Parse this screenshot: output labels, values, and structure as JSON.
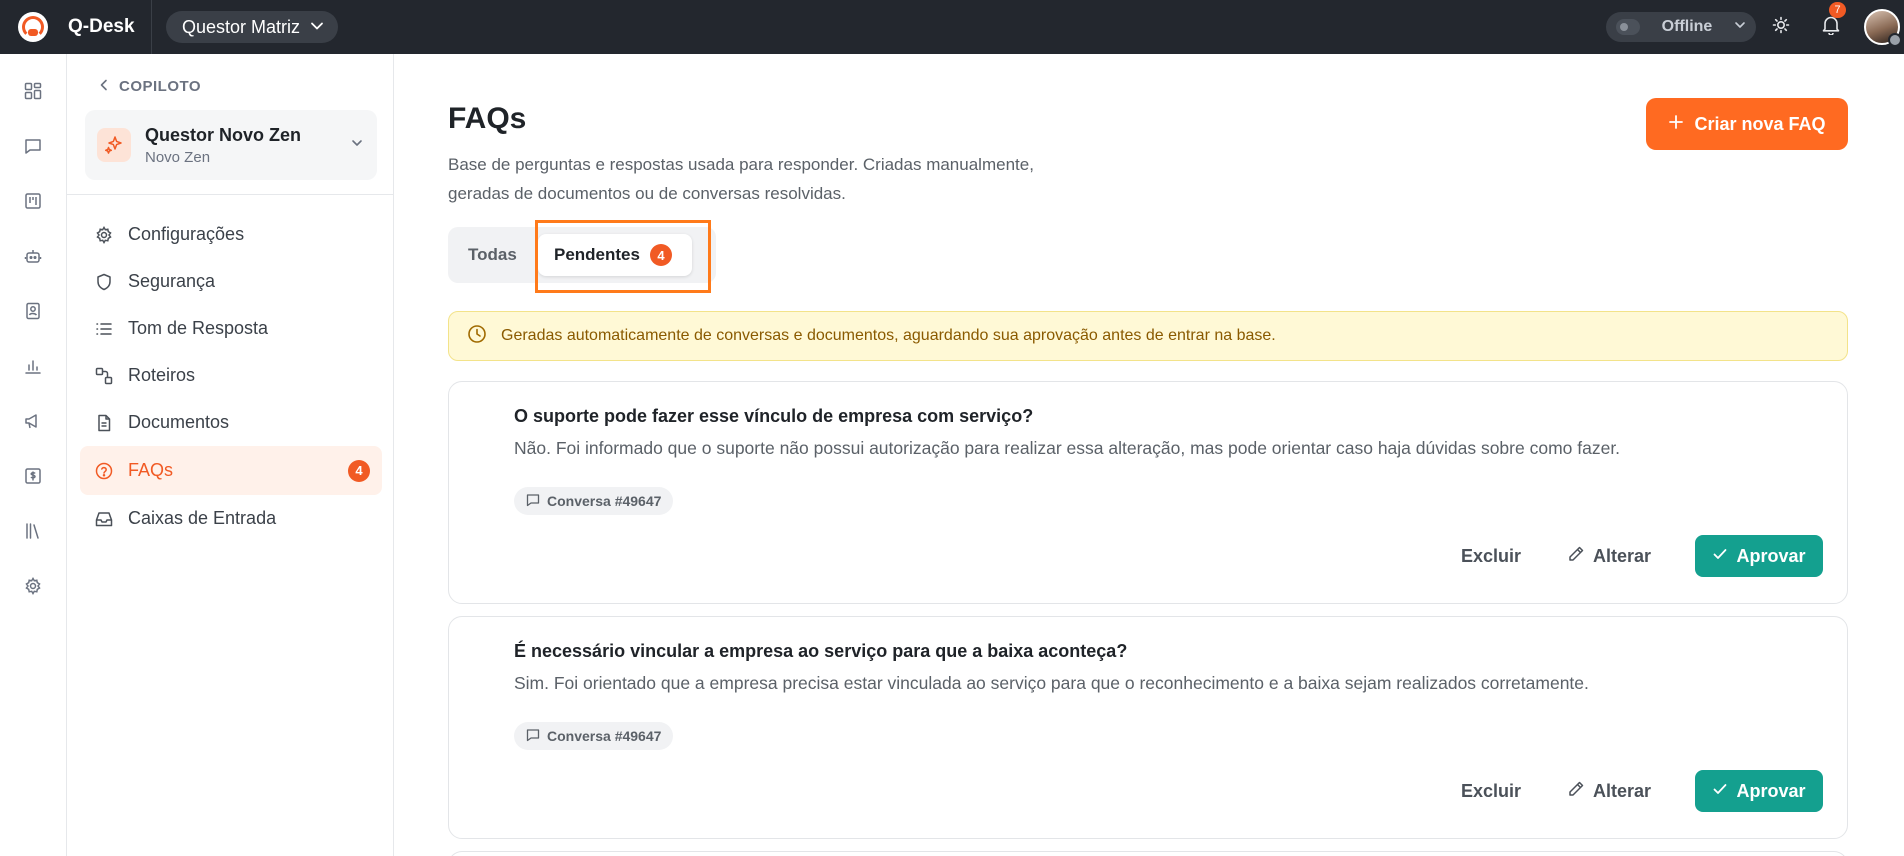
{
  "app": {
    "name": "Q-Desk",
    "workspace": "Questor Matriz",
    "status": "Offline",
    "notifications_count": "7"
  },
  "rail": {
    "icons": [
      "dashboard-icon",
      "chat-icon",
      "kanban-icon",
      "bot-icon",
      "contacts-icon",
      "reports-icon",
      "campaign-icon",
      "billing-icon",
      "library-icon",
      "settings-icon"
    ]
  },
  "sidepanel": {
    "back_label": "COPILOTO",
    "agent": {
      "title": "Questor Novo Zen",
      "subtitle": "Novo Zen"
    },
    "menu": [
      {
        "label": "Configurações",
        "icon": "gear-icon"
      },
      {
        "label": "Segurança",
        "icon": "shield-icon"
      },
      {
        "label": "Tom de Resposta",
        "icon": "list-icon"
      },
      {
        "label": "Roteiros",
        "icon": "flow-icon"
      },
      {
        "label": "Documentos",
        "icon": "document-icon"
      },
      {
        "label": "FAQs",
        "icon": "help-circle-icon",
        "badge": "4",
        "active": true
      },
      {
        "label": "Caixas de Entrada",
        "icon": "inbox-icon"
      }
    ]
  },
  "main": {
    "title": "FAQs",
    "description": "Base de perguntas e respostas usada para responder. Criadas manualmente, geradas de documentos ou de conversas resolvidas.",
    "create_button": "Criar nova FAQ",
    "tabs": [
      {
        "label": "Todas"
      },
      {
        "label": "Pendentes",
        "badge": "4",
        "active": true
      }
    ],
    "notice": "Geradas automaticamente de conversas e documentos, aguardando sua aprovação antes de entrar na base.",
    "faqs": [
      {
        "question": "O suporte pode fazer esse vínculo de empresa com serviço?",
        "answer": "Não. Foi informado que o suporte não possui autorização para realizar essa alteração, mas pode orientar caso haja dúvidas sobre como fazer.",
        "source": "Conversa #49647"
      },
      {
        "question": "É necessário vincular a empresa ao serviço para que a baixa aconteça?",
        "answer": "Sim. Foi orientado que a empresa precisa estar vinculada ao serviço para que o reconhecimento e a baixa sejam realizados corretamente.",
        "source": "Conversa #49647"
      }
    ],
    "actions": {
      "delete": "Excluir",
      "edit": "Alterar",
      "approve": "Aprovar"
    }
  },
  "colors": {
    "accent": "#ff6a21",
    "approve": "#14a08f",
    "topbar": "#23272e",
    "notice_bg": "#fff9d6",
    "highlight": "#ff7a1a"
  }
}
